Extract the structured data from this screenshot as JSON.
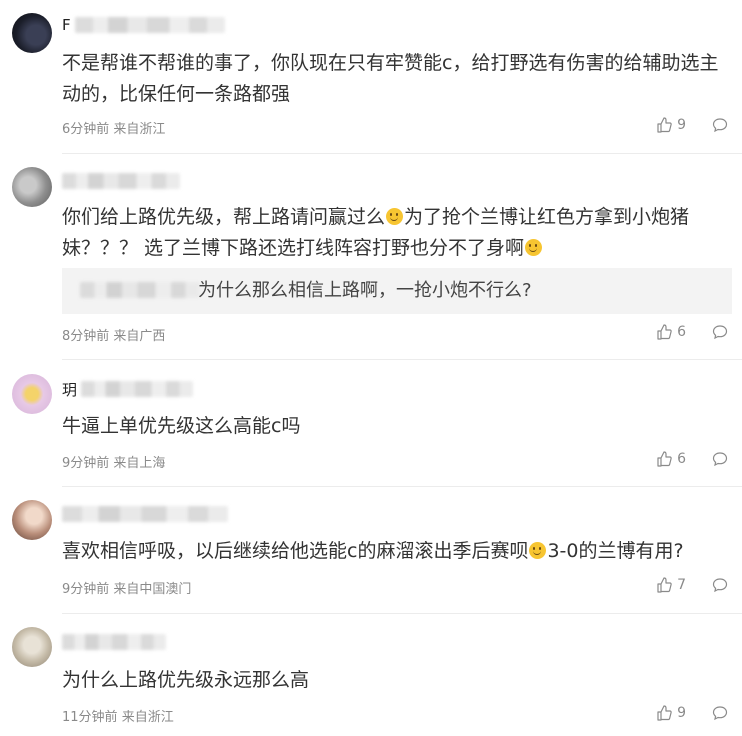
{
  "comments": [
    {
      "username_visible": "F",
      "text": "不是帮谁不帮谁的事了，你队现在只有牢赞能c，给打野选有伤害的给辅助选主动的，比保任何一条路都强",
      "time": "6分钟前",
      "location": "来自浙江",
      "likes": "9"
    },
    {
      "username_visible": "",
      "text_a": "你们给上路优先级，帮上路请问赢过么",
      "text_b": "为了抢个兰博让红色方拿到小炮猪妹？？？ 选了兰博下路还选打线阵容打野也分不了身啊",
      "reply_text": "为什么那么相信上路啊，一抢小炮不行么?",
      "time": "8分钟前",
      "location": "来自广西",
      "likes": "6"
    },
    {
      "username_visible": "玥",
      "text": "牛逼上单优先级这么高能c吗",
      "time": "9分钟前",
      "location": "来自上海",
      "likes": "6"
    },
    {
      "username_visible": "",
      "text_a": "喜欢相信呼吸，以后继续给他选能c的麻溜滚出季后赛呗",
      "text_b": "3-0的兰博有用?",
      "time": "9分钟前",
      "location": "来自中国澳门",
      "likes": "7"
    },
    {
      "username_visible": "",
      "text": "为什么上路优先级永远那么高",
      "time": "11分钟前",
      "location": "来自浙江",
      "likes": "9"
    }
  ],
  "icons": {
    "like": "thumbs-up-icon",
    "reply": "comment-bubble-icon"
  },
  "colors": {
    "meta": "#8a8a8a",
    "text": "#333333",
    "reply_bg": "#f3f3f3"
  }
}
